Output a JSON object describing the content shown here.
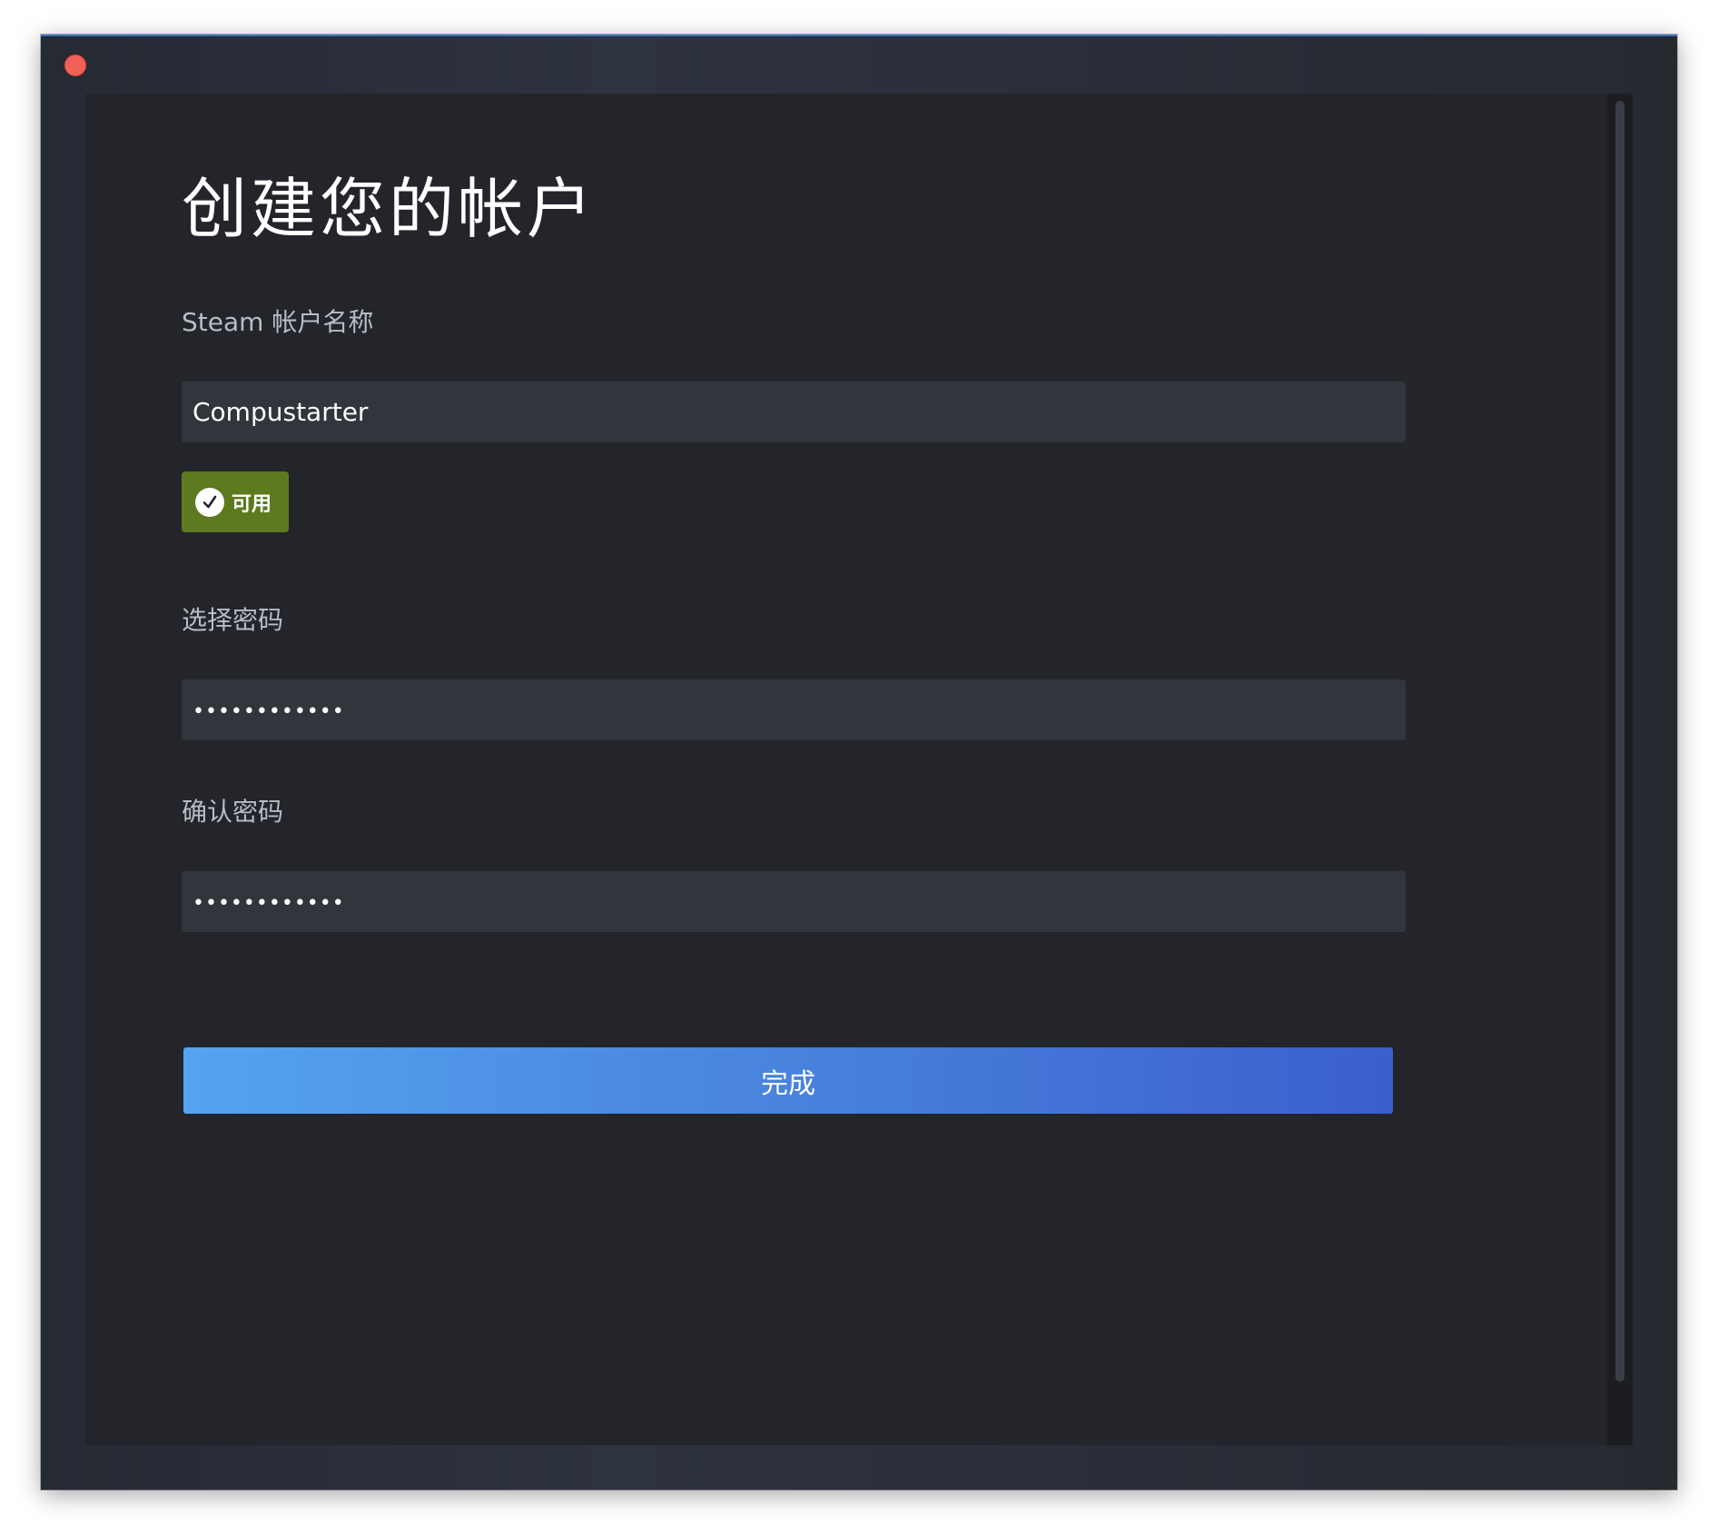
{
  "window": {
    "close_icon": "close-circle"
  },
  "page": {
    "title": "创建您的帐户"
  },
  "form": {
    "account_name": {
      "label": "Steam 帐户名称",
      "value": "Compustarter"
    },
    "availability": {
      "icon": "check-circle-icon",
      "label": "可用"
    },
    "password": {
      "label": "选择密码",
      "value": "••••••••••••"
    },
    "confirm_password": {
      "label": "确认密码",
      "value": "••••••••••••"
    },
    "submit_label": "完成"
  },
  "colors": {
    "badge_available": "#5d7a1f",
    "button_gradient_start": "#55a4ef",
    "button_gradient_end": "#3b5fcc"
  }
}
